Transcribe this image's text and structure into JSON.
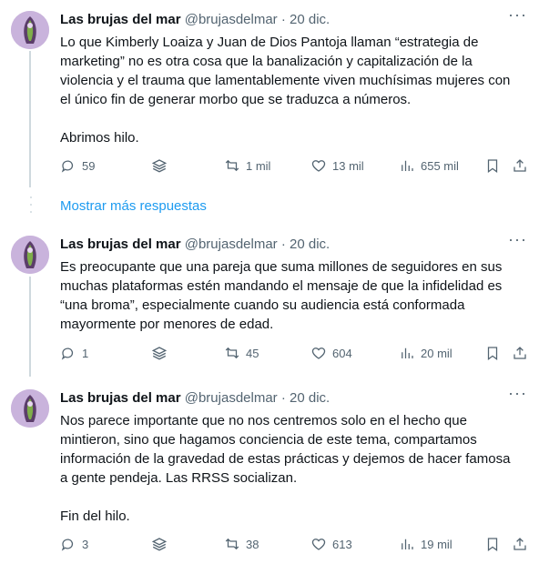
{
  "tweets": [
    {
      "name": "Las brujas del mar",
      "handle": "@brujasdelmar",
      "separator": "·",
      "date": "20 dic.",
      "text": "Lo que Kimberly Loaiza y Juan de Dios Pantoja llaman “estrategia de marketing” no es otra cosa que la banalización y capitalización de la violencia y el trauma que lamentablemente viven muchísimas mujeres con el único fin de generar morbo que se traduzca a números.\n\nAbrimos hilo.",
      "replies": "59",
      "retweets": "1 mil",
      "likes": "13 mil",
      "views": "655 mil"
    },
    {
      "name": "Las brujas del mar",
      "handle": "@brujasdelmar",
      "separator": "·",
      "date": "20 dic.",
      "text": "Es preocupante que una pareja que suma millones de seguidores en sus muchas plataformas estén mandando el mensaje de que la infidelidad es “una broma”, especialmente cuando su audiencia está conformada mayormente por menores de edad.",
      "replies": "1",
      "retweets": "45",
      "likes": "604",
      "views": "20 mil"
    },
    {
      "name": "Las brujas del mar",
      "handle": "@brujasdelmar",
      "separator": "·",
      "date": "20 dic.",
      "text": "Nos parece importante que no nos centremos solo en el hecho que mintieron, sino que hagamos conciencia de este tema, compartamos información de la gravedad de estas prácticas y dejemos de hacer famosa a gente pendeja. Las RRSS socializan.\n\nFin del hilo.",
      "replies": "3",
      "retweets": "38",
      "likes": "613",
      "views": "19 mil"
    }
  ],
  "show_more_replies": "Mostrar más respuestas",
  "colors": {
    "link": "#1d9bf0",
    "muted": "#536471",
    "text": "#0f1419",
    "line": "#cfd9de"
  }
}
